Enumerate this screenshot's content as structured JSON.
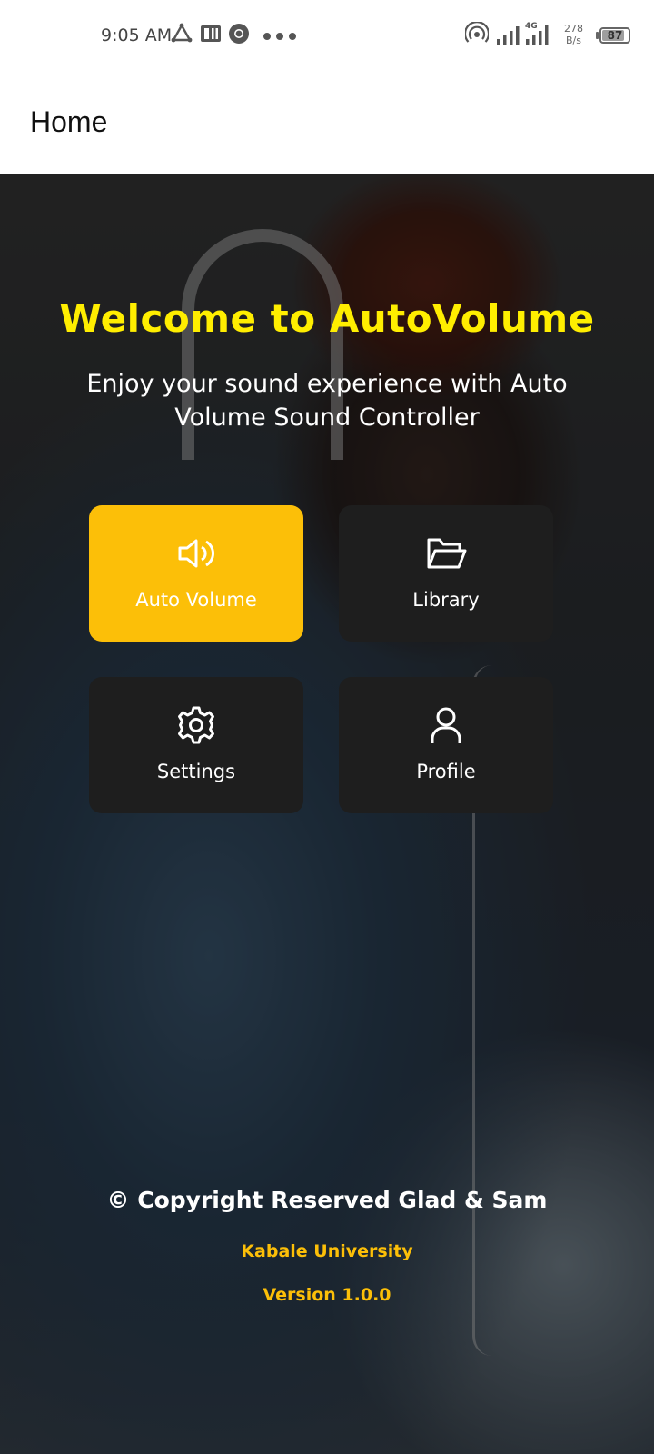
{
  "status_bar": {
    "time": "9:05 AM",
    "left_icons": [
      "triangle-app-icon",
      "pdf-app-icon",
      "chrome-icon",
      "more-dots-icon"
    ],
    "right_icons": [
      "hotspot-icon",
      "signal-icon",
      "signal-4g-icon",
      "battery-icon"
    ],
    "net_speed_value": "278",
    "net_speed_unit": "B/s",
    "network_type": "4G",
    "battery_level": "87",
    "battery_percent": 87
  },
  "app_bar": {
    "title": "Home"
  },
  "hero": {
    "welcome": "Welcome to AutoVolume",
    "subtitle": "Enjoy your sound experience with Auto Volume Sound Controller"
  },
  "menu": {
    "tiles": [
      {
        "label": "Auto Volume",
        "icon": "speaker-icon",
        "active": true
      },
      {
        "label": "Library",
        "icon": "folder-open-icon",
        "active": false
      },
      {
        "label": "Settings",
        "icon": "gear-icon",
        "active": false
      },
      {
        "label": "Profile",
        "icon": "user-icon",
        "active": false
      }
    ]
  },
  "footer": {
    "copyright": "© Copyright Reserved Glad & Sam",
    "university": "Kabale University",
    "version": "Version 1.0.0"
  },
  "colors": {
    "accent": "#fcbf08",
    "welcome_yellow": "#ffee00",
    "tile_dark": "#1e1e1e"
  }
}
